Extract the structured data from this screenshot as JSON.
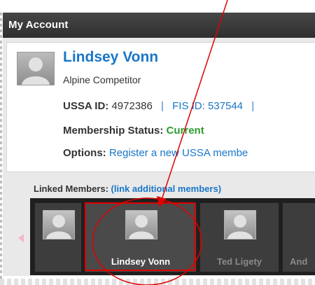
{
  "header": {
    "title": "My Account"
  },
  "profile": {
    "name": "Lindsey Vonn",
    "subtitle": "Alpine Competitor",
    "ussa_label": "USSA ID:",
    "ussa_id": "4972386",
    "fis_label": "FIS ID: 537544",
    "status_label": "Membership Status:",
    "status_value": "Current",
    "options_label": "Options:",
    "options_link": "Register a new USSA membe"
  },
  "linked": {
    "label": "Linked Members:",
    "add_link": "(link additional members)",
    "members": [
      {
        "name": ""
      },
      {
        "name": "Lindsey Vonn",
        "selected": true
      },
      {
        "name": "Ted Ligety"
      },
      {
        "name": "And"
      }
    ]
  },
  "annotation": {
    "color": "#e00000"
  }
}
